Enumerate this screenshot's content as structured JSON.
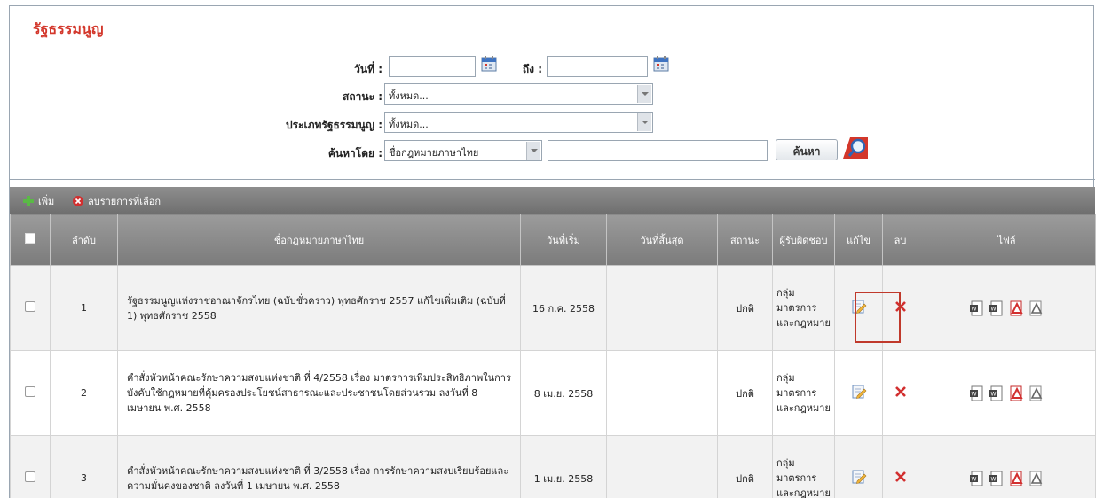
{
  "page_title": "รัฐธรรมนูญ",
  "search": {
    "date_from_label": "วันที่ :",
    "date_to_label": "ถึง :",
    "date_from_value": "",
    "date_to_value": "",
    "status_label": "สถานะ :",
    "status_value": "ทั้งหมด...",
    "type_label": "ประเภทรัฐธรรมนูญ :",
    "type_value": "ทั้งหมด...",
    "search_by_label": "ค้นหาโดย :",
    "search_by_value": "ชื่อกฎหมายภาษาไทย",
    "keyword_value": "",
    "search_button": "ค้นหา"
  },
  "toolbar": {
    "add_label": "เพิ่ม",
    "delete_selected_label": "ลบรายการที่เลือก"
  },
  "table": {
    "headers": {
      "seq": "ลำดับ",
      "name": "ชื่อกฎหมายภาษาไทย",
      "start": "วันที่เริ่ม",
      "end": "วันที่สิ้นสุด",
      "status": "สถานะ",
      "resp": "ผู้รับผิดชอบ",
      "edit": "แก้ไข",
      "del": "ลบ",
      "file": "ไฟล์"
    },
    "rows": [
      {
        "seq": "1",
        "name": "รัฐธรรมนูญแห่งราชอาณาจักรไทย (ฉบับชั่วคราว) พุทธศักราช 2557 แก้ไขเพิ่มเติม (ฉบับที่ 1) พุทธศักราช 2558",
        "start": "16 ก.ค. 2558",
        "end": "",
        "status": "ปกติ",
        "resp": "กลุ่มมาตรการและกฎหมาย"
      },
      {
        "seq": "2",
        "name": "คำสั่งหัวหน้าคณะรักษาความสงบแห่งชาติ ที่ 4/2558 เรื่อง มาตรการเพิ่มประสิทธิภาพในการบังคับใช้กฎหมายที่คุ้มครองประโยชน์สาธารณะและประชาชนโดยส่วนรวม ลงวันที่ 8 เมษายน พ.ศ. 2558",
        "start": "8 เม.ย. 2558",
        "end": "",
        "status": "ปกติ",
        "resp": "กลุ่มมาตรการและกฎหมาย"
      },
      {
        "seq": "3",
        "name": "คำสั่งหัวหน้าคณะรักษาความสงบแห่งชาติ ที่ 3/2558 เรื่อง การรักษาความสงบเรียบร้อยและความมั่นคงของชาติ ลงวันที่ 1 เมษายน พ.ศ. 2558",
        "start": "1 เม.ย. 2558",
        "end": "",
        "status": "ปกติ",
        "resp": "กลุ่มมาตรการและกฎหมาย"
      }
    ]
  },
  "colors": {
    "title_red": "#d3372b",
    "toolbar_gray": "#7b7b7b",
    "delete_red": "#d22f2f",
    "highlight_red": "#c0392b"
  },
  "icons": [
    "calendar-icon",
    "search-icon",
    "add-icon",
    "delete-circle-icon",
    "edit-icon",
    "delete-x-icon",
    "word-file-icon",
    "pdf-file-icon"
  ]
}
